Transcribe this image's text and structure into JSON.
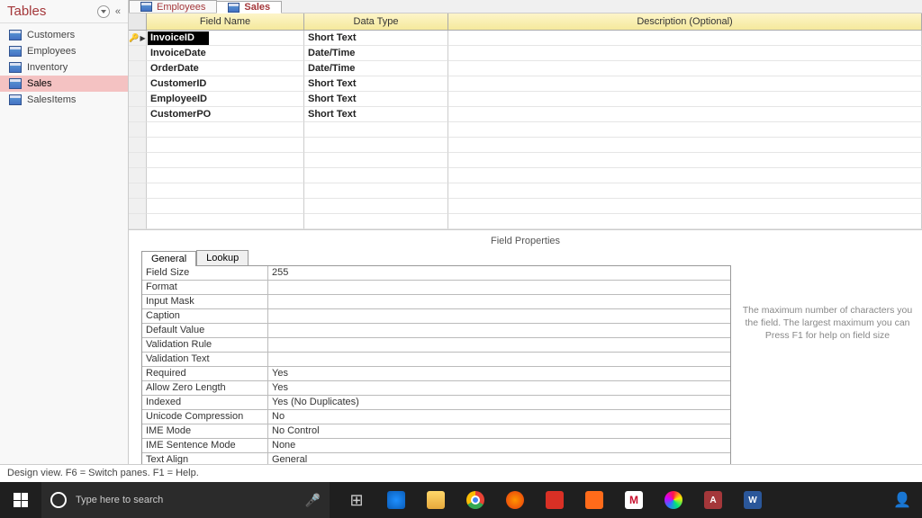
{
  "sidebar": {
    "title": "Tables",
    "items": [
      {
        "label": "Customers"
      },
      {
        "label": "Employees"
      },
      {
        "label": "Inventory"
      },
      {
        "label": "Sales"
      },
      {
        "label": "SalesItems"
      }
    ],
    "active_index": 3
  },
  "tabs": [
    {
      "label": "Employees"
    },
    {
      "label": "Sales"
    }
  ],
  "active_tab": 1,
  "grid": {
    "headers": {
      "field": "Field Name",
      "type": "Data Type",
      "desc": "Description (Optional)"
    },
    "rows": [
      {
        "field": "InvoiceID",
        "type": "Short Text",
        "desc": "",
        "pk": true,
        "active": true
      },
      {
        "field": "InvoiceDate",
        "type": "Date/Time",
        "desc": ""
      },
      {
        "field": "OrderDate",
        "type": "Date/Time",
        "desc": ""
      },
      {
        "field": "CustomerID",
        "type": "Short Text",
        "desc": ""
      },
      {
        "field": "EmployeeID",
        "type": "Short Text",
        "desc": ""
      },
      {
        "field": "CustomerPO",
        "type": "Short Text",
        "desc": ""
      }
    ]
  },
  "fp": {
    "title": "Field Properties",
    "tabs": {
      "general": "General",
      "lookup": "Lookup"
    },
    "rows": [
      {
        "label": "Field Size",
        "value": "255"
      },
      {
        "label": "Format",
        "value": ""
      },
      {
        "label": "Input Mask",
        "value": ""
      },
      {
        "label": "Caption",
        "value": ""
      },
      {
        "label": "Default Value",
        "value": ""
      },
      {
        "label": "Validation Rule",
        "value": ""
      },
      {
        "label": "Validation Text",
        "value": ""
      },
      {
        "label": "Required",
        "value": "Yes"
      },
      {
        "label": "Allow Zero Length",
        "value": "Yes"
      },
      {
        "label": "Indexed",
        "value": "Yes (No Duplicates)"
      },
      {
        "label": "Unicode Compression",
        "value": "No"
      },
      {
        "label": "IME Mode",
        "value": "No Control"
      },
      {
        "label": "IME Sentence Mode",
        "value": "None"
      },
      {
        "label": "Text Align",
        "value": "General"
      }
    ],
    "help": "The maximum number of characters you\nthe field. The largest maximum you can\nPress F1 for help on field size"
  },
  "status": "Design view.  F6 = Switch panes.  F1 = Help.",
  "taskbar": {
    "search_placeholder": "Type here to search"
  }
}
